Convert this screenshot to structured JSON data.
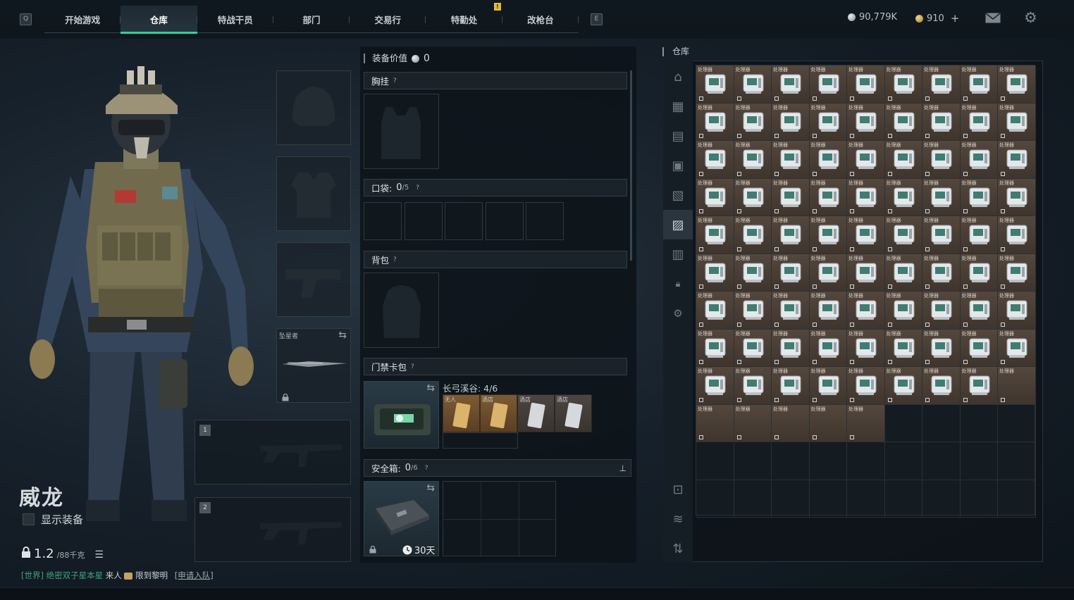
{
  "nav": {
    "prev_key": "Q",
    "next_key": "E",
    "tabs": [
      {
        "label": "开始游戏"
      },
      {
        "label": "仓库"
      },
      {
        "label": "特战干员"
      },
      {
        "label": "部门"
      },
      {
        "label": "交易行"
      },
      {
        "label": "特勤处"
      },
      {
        "label": "改枪台"
      }
    ],
    "notification": "!"
  },
  "currency": {
    "money": "90,779K",
    "coins": "910",
    "add_label": "+"
  },
  "operator": {
    "name": "威龙",
    "show_gear_label": "显示装备",
    "weight": "1.2",
    "weight_max": "/88千克"
  },
  "chat": {
    "channel": "[世界]",
    "sender": "绝密双子星本星",
    "message_a": "来人",
    "message_b": "限到黎明",
    "invite": "[申请入队]"
  },
  "slots": {
    "melee_label": "坠星者",
    "weapon1_num": "1",
    "weapon2_num": "2"
  },
  "gear": {
    "value_label": "装备价值",
    "value": "0",
    "chest_label": "胸挂",
    "pockets_label": "口袋:",
    "pockets_used": "0",
    "pockets_max": "/5",
    "backpack_label": "背包",
    "keycard_label": "门禁卡包",
    "keycard_map": "长弓溪谷: 4/6",
    "keycards": [
      "无人",
      "酒店",
      "酒店",
      "酒店"
    ],
    "safebox_label": "安全箱:",
    "safebox_used": "0",
    "safebox_max": "/6",
    "safebox_timer": "30天",
    "help": "?"
  },
  "storage": {
    "title": "仓库",
    "item_label": "处理器",
    "columns": 9,
    "rows": 12,
    "icon_rows": 9,
    "icon_last_row_count": 8,
    "extra_label_row_count": 5,
    "item_color": "#4a3f36"
  }
}
